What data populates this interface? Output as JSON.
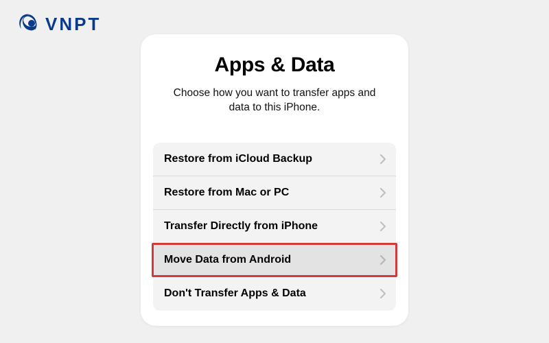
{
  "brand": {
    "name": "VNPT"
  },
  "screen": {
    "title": "Apps & Data",
    "subtitle": "Choose how you want to transfer apps and data to this iPhone."
  },
  "options": [
    {
      "label": "Restore from iCloud Backup",
      "highlighted": false
    },
    {
      "label": "Restore from Mac or PC",
      "highlighted": false
    },
    {
      "label": "Transfer Directly from iPhone",
      "highlighted": false
    },
    {
      "label": "Move Data from Android",
      "highlighted": true
    },
    {
      "label": "Don't Transfer Apps & Data",
      "highlighted": false
    }
  ]
}
